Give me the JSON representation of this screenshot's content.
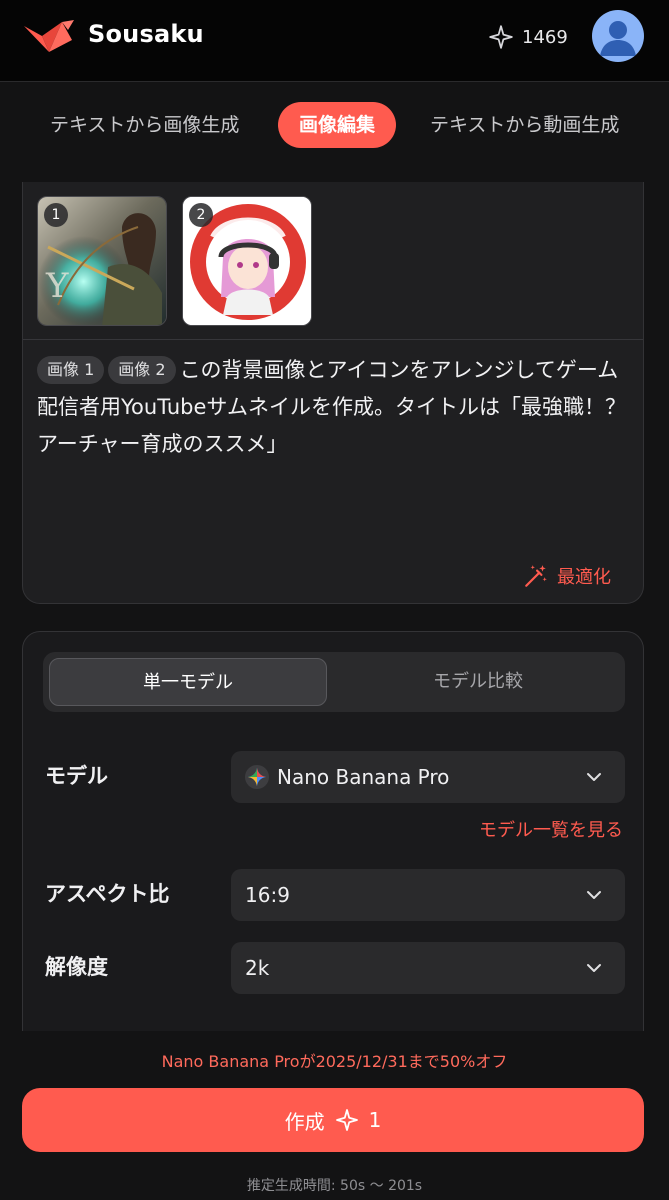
{
  "header": {
    "app_title": "Sousaku",
    "credits": "1469",
    "icons": {
      "logo": "origami-crane-logo",
      "credits": "sparkle-icon",
      "avatar": "user-avatar"
    }
  },
  "mode_tabs": [
    {
      "label": "テキストから画像生成",
      "active": false
    },
    {
      "label": "画像編集",
      "active": true
    },
    {
      "label": "テキストから動画生成",
      "active": false
    }
  ],
  "prompt": {
    "images": [
      {
        "number": "1"
      },
      {
        "number": "2"
      }
    ],
    "chips": [
      "画像 1",
      "画像 2"
    ],
    "text": "この背景画像とアイコンをアレンジしてゲーム配信者用YouTubeサムネイルを作成。タイトルは「最強職！？アーチャー育成のススメ」",
    "optimize_label": "最適化"
  },
  "settings": {
    "segment": {
      "single": "単一モデル",
      "compare": "モデル比較",
      "selected": "単一モデル"
    },
    "model": {
      "label": "モデル",
      "value": "Nano Banana Pro"
    },
    "model_list_link": "モデル一覧を見る",
    "aspect": {
      "label": "アスペクト比",
      "value": "16:9"
    },
    "resolution": {
      "label": "解像度",
      "value": "2k"
    }
  },
  "footer": {
    "promo": "Nano Banana Proが2025/12/31まで50%オフ",
    "create_label": "作成",
    "create_cost": "1",
    "estimate": "推定生成時間: 50s 〜 201s"
  },
  "colors": {
    "accent": "#ff5b4f",
    "background": "#131314",
    "panel": "#1f1f21",
    "control": "#2a2a2c"
  }
}
